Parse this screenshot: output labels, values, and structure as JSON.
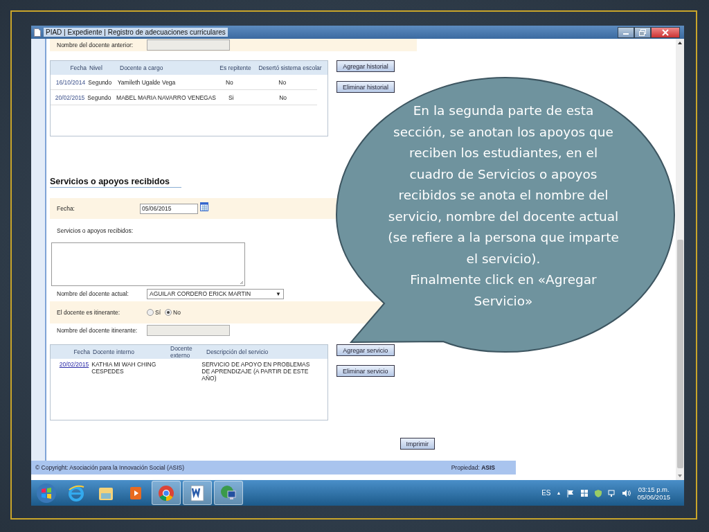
{
  "window": {
    "title": "PIAD | Expediente | Registro de adecuaciones curriculares"
  },
  "previous_teacher": {
    "label": "Nombre del docente anterior:"
  },
  "history_table": {
    "columns": [
      "Fecha",
      "Nivel",
      "Docente a cargo",
      "Es repitente",
      "Desertó sistema escolar"
    ],
    "rows": [
      {
        "date": "16/10/2014",
        "level": "Segundo",
        "teacher": "Yamileth Ugalde Vega",
        "repeater": "No",
        "dropout": "No"
      },
      {
        "date": "20/02/2015",
        "level": "Segundo",
        "teacher": "MABEL MARIA NAVARRO VENEGAS",
        "repeater": "Si",
        "dropout": "No"
      }
    ]
  },
  "history_buttons": [
    "Agregar historial",
    "Eliminar historial"
  ],
  "section_title": "Servicios o apoyos recibidos",
  "date_field": {
    "label": "Fecha:",
    "value": "05/06/2015"
  },
  "services_field": {
    "label": "Servicios o apoyos recibidos:"
  },
  "current_teacher": {
    "label": "Nombre del docente actual:",
    "value": "AGUILAR CORDERO ERICK MARTIN",
    "arrow": "▼"
  },
  "itinerant": {
    "label": "El docente es itinerante:",
    "options": [
      {
        "label": "Sí",
        "selected": false
      },
      {
        "label": "No",
        "selected": true
      }
    ]
  },
  "itinerant_name": {
    "label": "Nombre del docente itinerante:"
  },
  "services_table": {
    "columns": [
      "Fecha",
      "Docente interno",
      "Docente externo",
      "Descripción del servicio"
    ],
    "rows": [
      {
        "date": "20/02/2015",
        "internal": "KATHIA MI WAH CHING CESPEDES",
        "description": "SERVICIO DE APOYO EN PROBLEMAS DE APRENDIZAJE (A PARTIR DE ESTE AÑO)"
      }
    ]
  },
  "service_buttons": [
    "Agregar servicio",
    "Eliminar servicio"
  ],
  "print_button": "Imprimir",
  "footer": {
    "copyright": "© Copyright: Asociación para la Innovación Social (ASIS)",
    "property": "Propiedad: **ASIS**"
  },
  "taskbar": {
    "apps": [
      {
        "kind": "start",
        "open": false
      },
      {
        "kind": "browser",
        "open": false
      },
      {
        "kind": "folder",
        "open": false
      },
      {
        "kind": "media",
        "open": false
      },
      {
        "kind": "chrome",
        "open": true
      },
      {
        "kind": "word",
        "open": true
      },
      {
        "kind": "network",
        "open": true
      }
    ],
    "language": "ES",
    "tray_arrow": "▲",
    "time": "03:15 p.m.",
    "date": "05/06/2015"
  },
  "callout": {
    "text": "En la segunda parte de esta sección, se anotan los apoyos que reciben los estudiantes, en el cuadro de Servicios o apoyos recibidos se anota el nombre del servicio, nombre del docente actual  (se refiere a la persona que imparte el servicio).",
    "action": "Finalmente click en «Agregar Servicio»"
  }
}
